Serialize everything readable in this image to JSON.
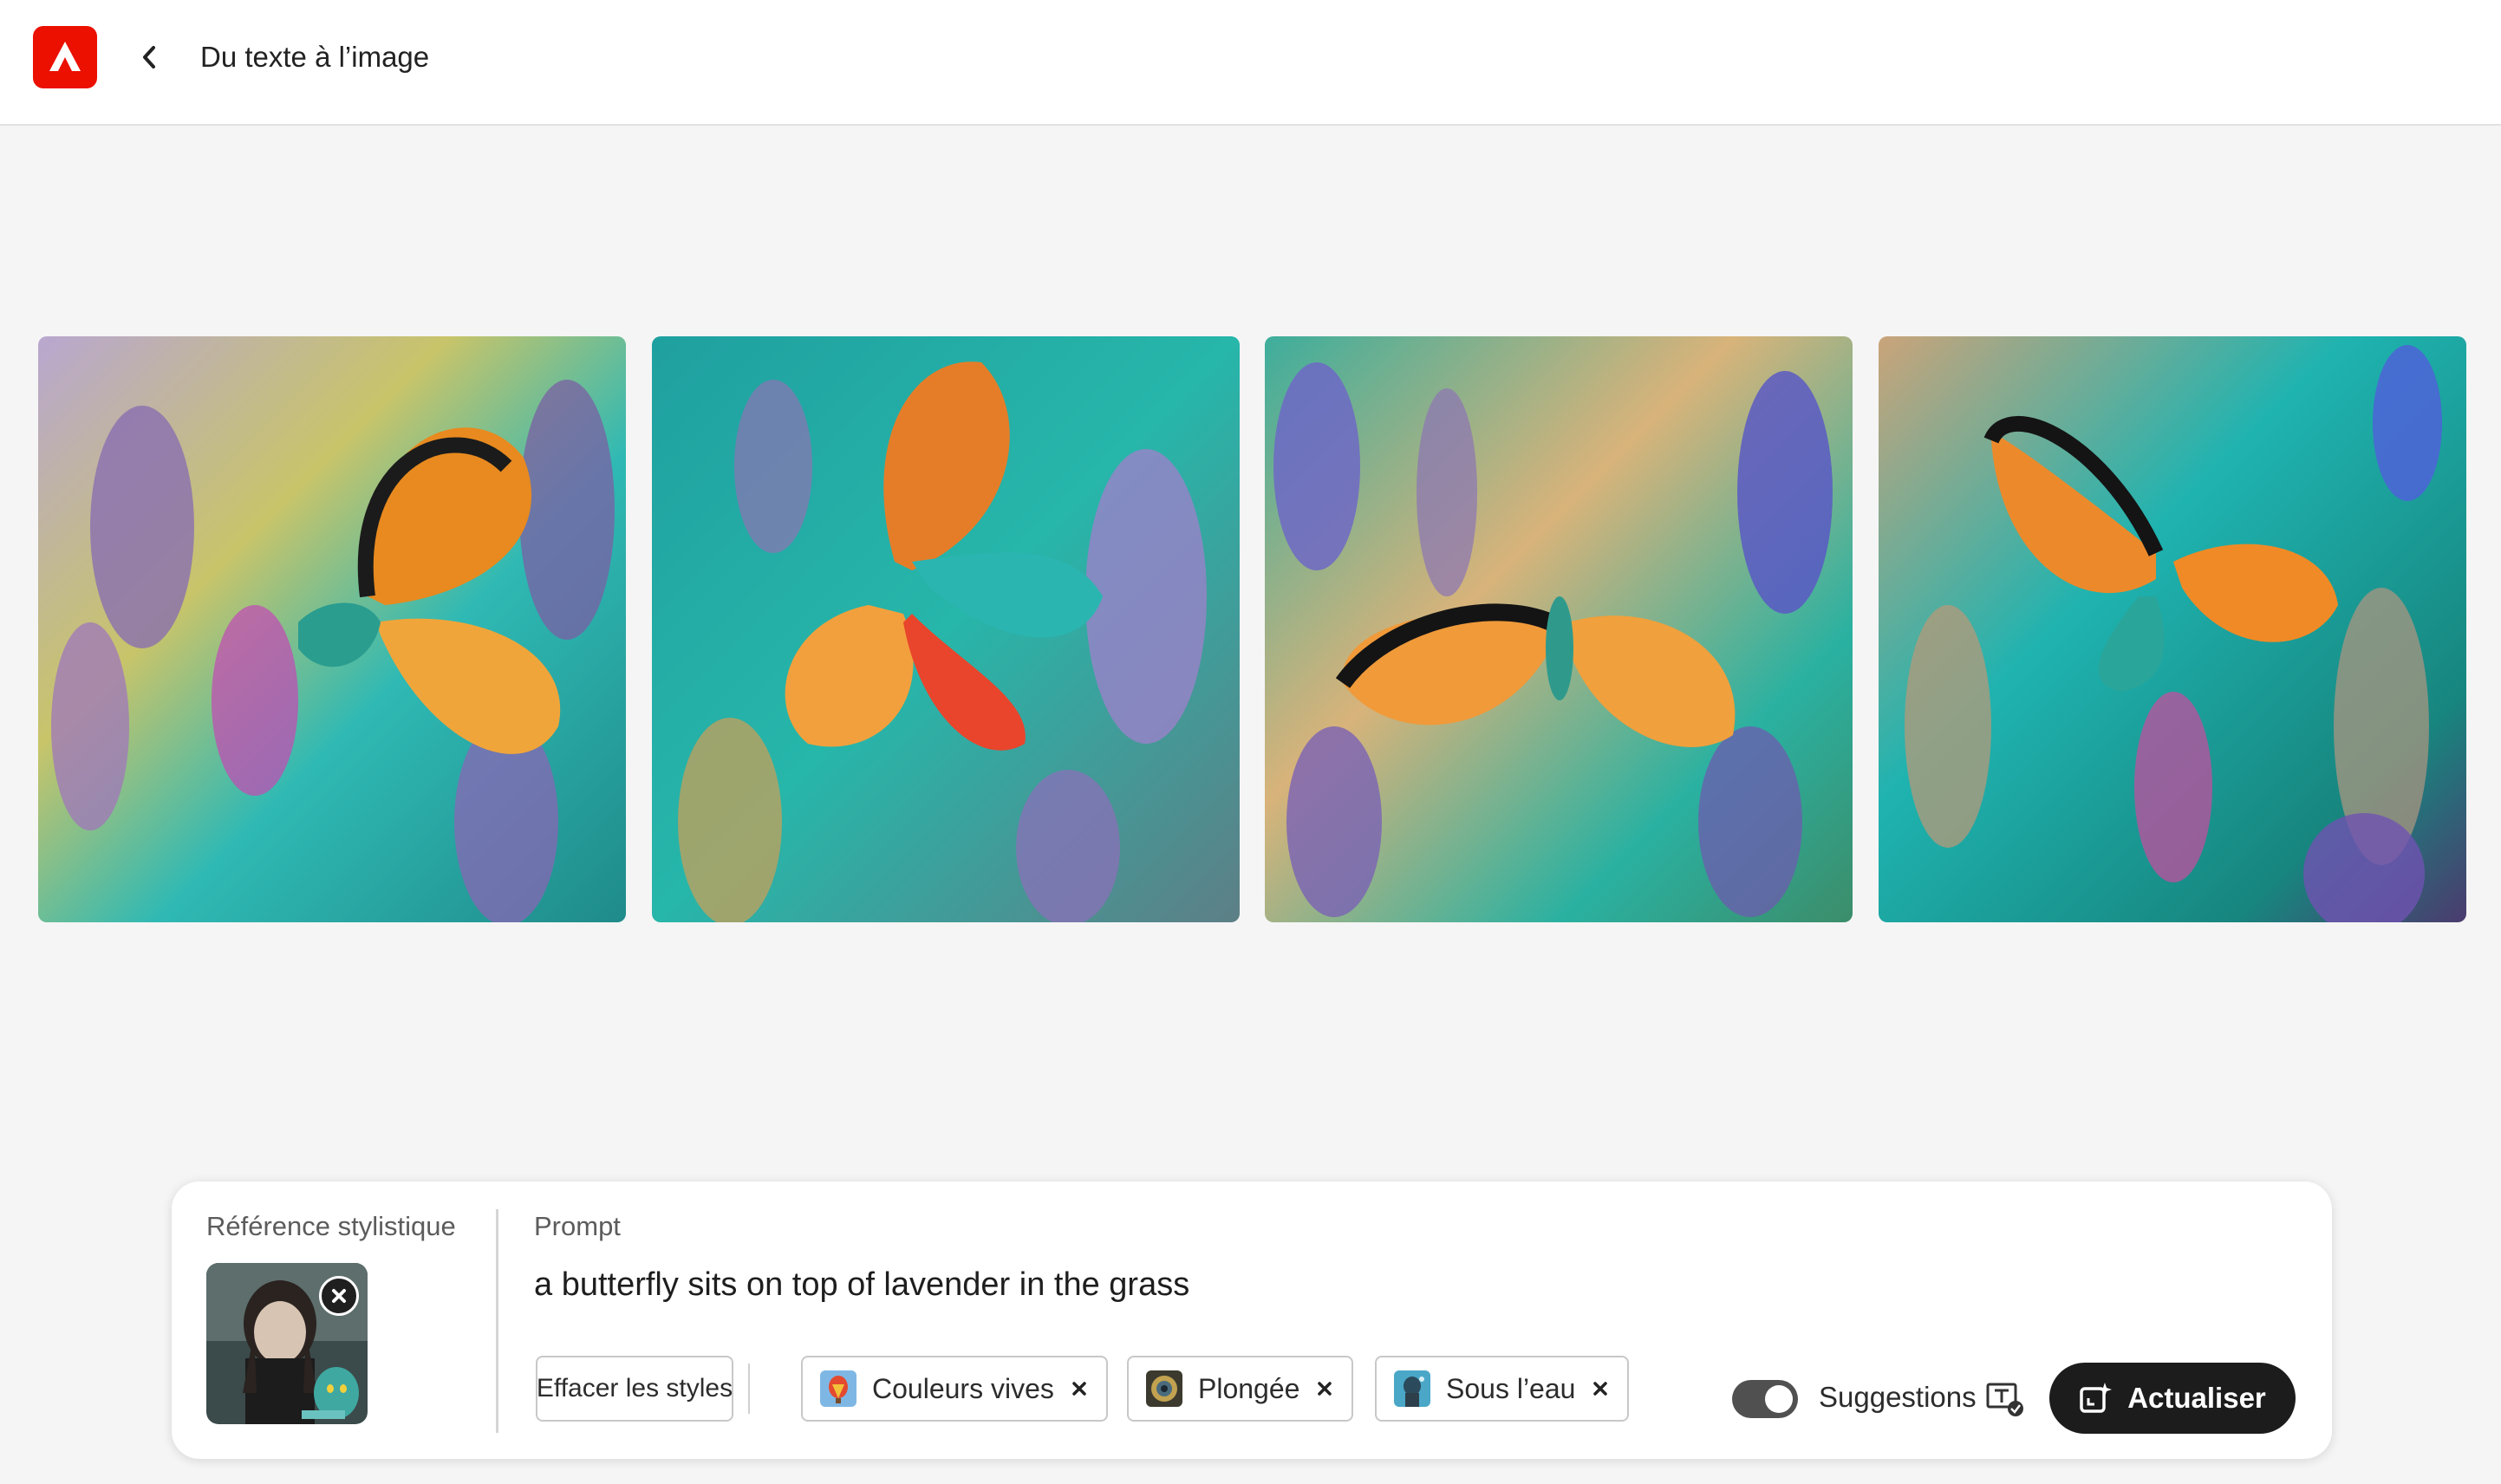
{
  "header": {
    "logo_icon": "adobe-express-logo",
    "back_icon": "chevron-left-icon",
    "title": "Du texte à l’image"
  },
  "gallery": {
    "images": [
      {
        "subject": "butterfly-painting-1"
      },
      {
        "subject": "butterfly-painting-2"
      },
      {
        "subject": "butterfly-painting-3"
      },
      {
        "subject": "butterfly-painting-4"
      }
    ]
  },
  "panel": {
    "style_reference": {
      "label": "Référence stylistique",
      "remove_icon": "close-circle-icon"
    },
    "prompt": {
      "label": "Prompt",
      "value": "a butterfly sits on top of lavender in the grass"
    },
    "clear_styles_label": "Effacer les styles",
    "style_chips": [
      {
        "label": "Couleurs vives",
        "close_icon": "close-icon"
      },
      {
        "label": "Plongée",
        "close_icon": "close-icon"
      },
      {
        "label": "Sous l’eau",
        "close_icon": "close-icon"
      }
    ],
    "suggestions": {
      "label": "Suggestions",
      "enabled": true
    },
    "refresh_button_label": "Actualiser"
  },
  "colors": {
    "brand_red": "#eb1000",
    "primary_button": "#1c1c1c",
    "background": "#f5f5f5"
  }
}
